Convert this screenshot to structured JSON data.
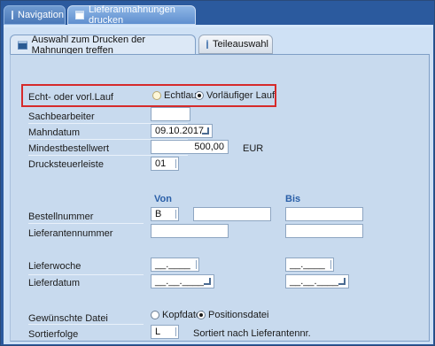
{
  "tabs": {
    "navigation": "Navigation",
    "main": "Lieferanmahnungen drucken"
  },
  "subtabs": {
    "selection": "Auswahl zum Drucken der Mahnungen treffen",
    "parts": "Teileauswahl"
  },
  "form": {
    "run_label": "Echt- oder vorl.Lauf",
    "run_options": [
      "Echtlauf",
      "Vorläufiger Lauf"
    ],
    "run_selected": "Vorläufiger Lauf",
    "clerk_label": "Sachbearbeiter",
    "clerk_value": "",
    "dunning_date_label": "Mahndatum",
    "dunning_date_value": "09.10.2017",
    "min_order_label": "Mindestbestellwert",
    "min_order_value": "500,00",
    "currency": "EUR",
    "print_control_label": "Drucksteuerleiste",
    "print_control_value": "01",
    "col_from": "Von",
    "col_to": "Bis",
    "order_no_label": "Bestellnummer",
    "order_no_prefix": "B",
    "supplier_no_label": "Lieferantennummer",
    "delivery_week_label": "Lieferwoche",
    "delivery_week_placeholder": "__.____",
    "delivery_date_label": "Lieferdatum",
    "delivery_date_placeholder": "__.__.____",
    "file_label": "Gewünschte Datei",
    "file_options": [
      "Kopfdatei",
      "Positionsdatei"
    ],
    "file_selected": "Positionsdatei",
    "sort_label": "Sortierfolge",
    "sort_value": "L",
    "sort_desc": "Sortiert nach Lieferantennr."
  },
  "colors": {
    "frame": "#2b5a9e",
    "panel": "#c8daee",
    "header_text": "#2a5fa8",
    "highlight": "#d62a2a"
  }
}
